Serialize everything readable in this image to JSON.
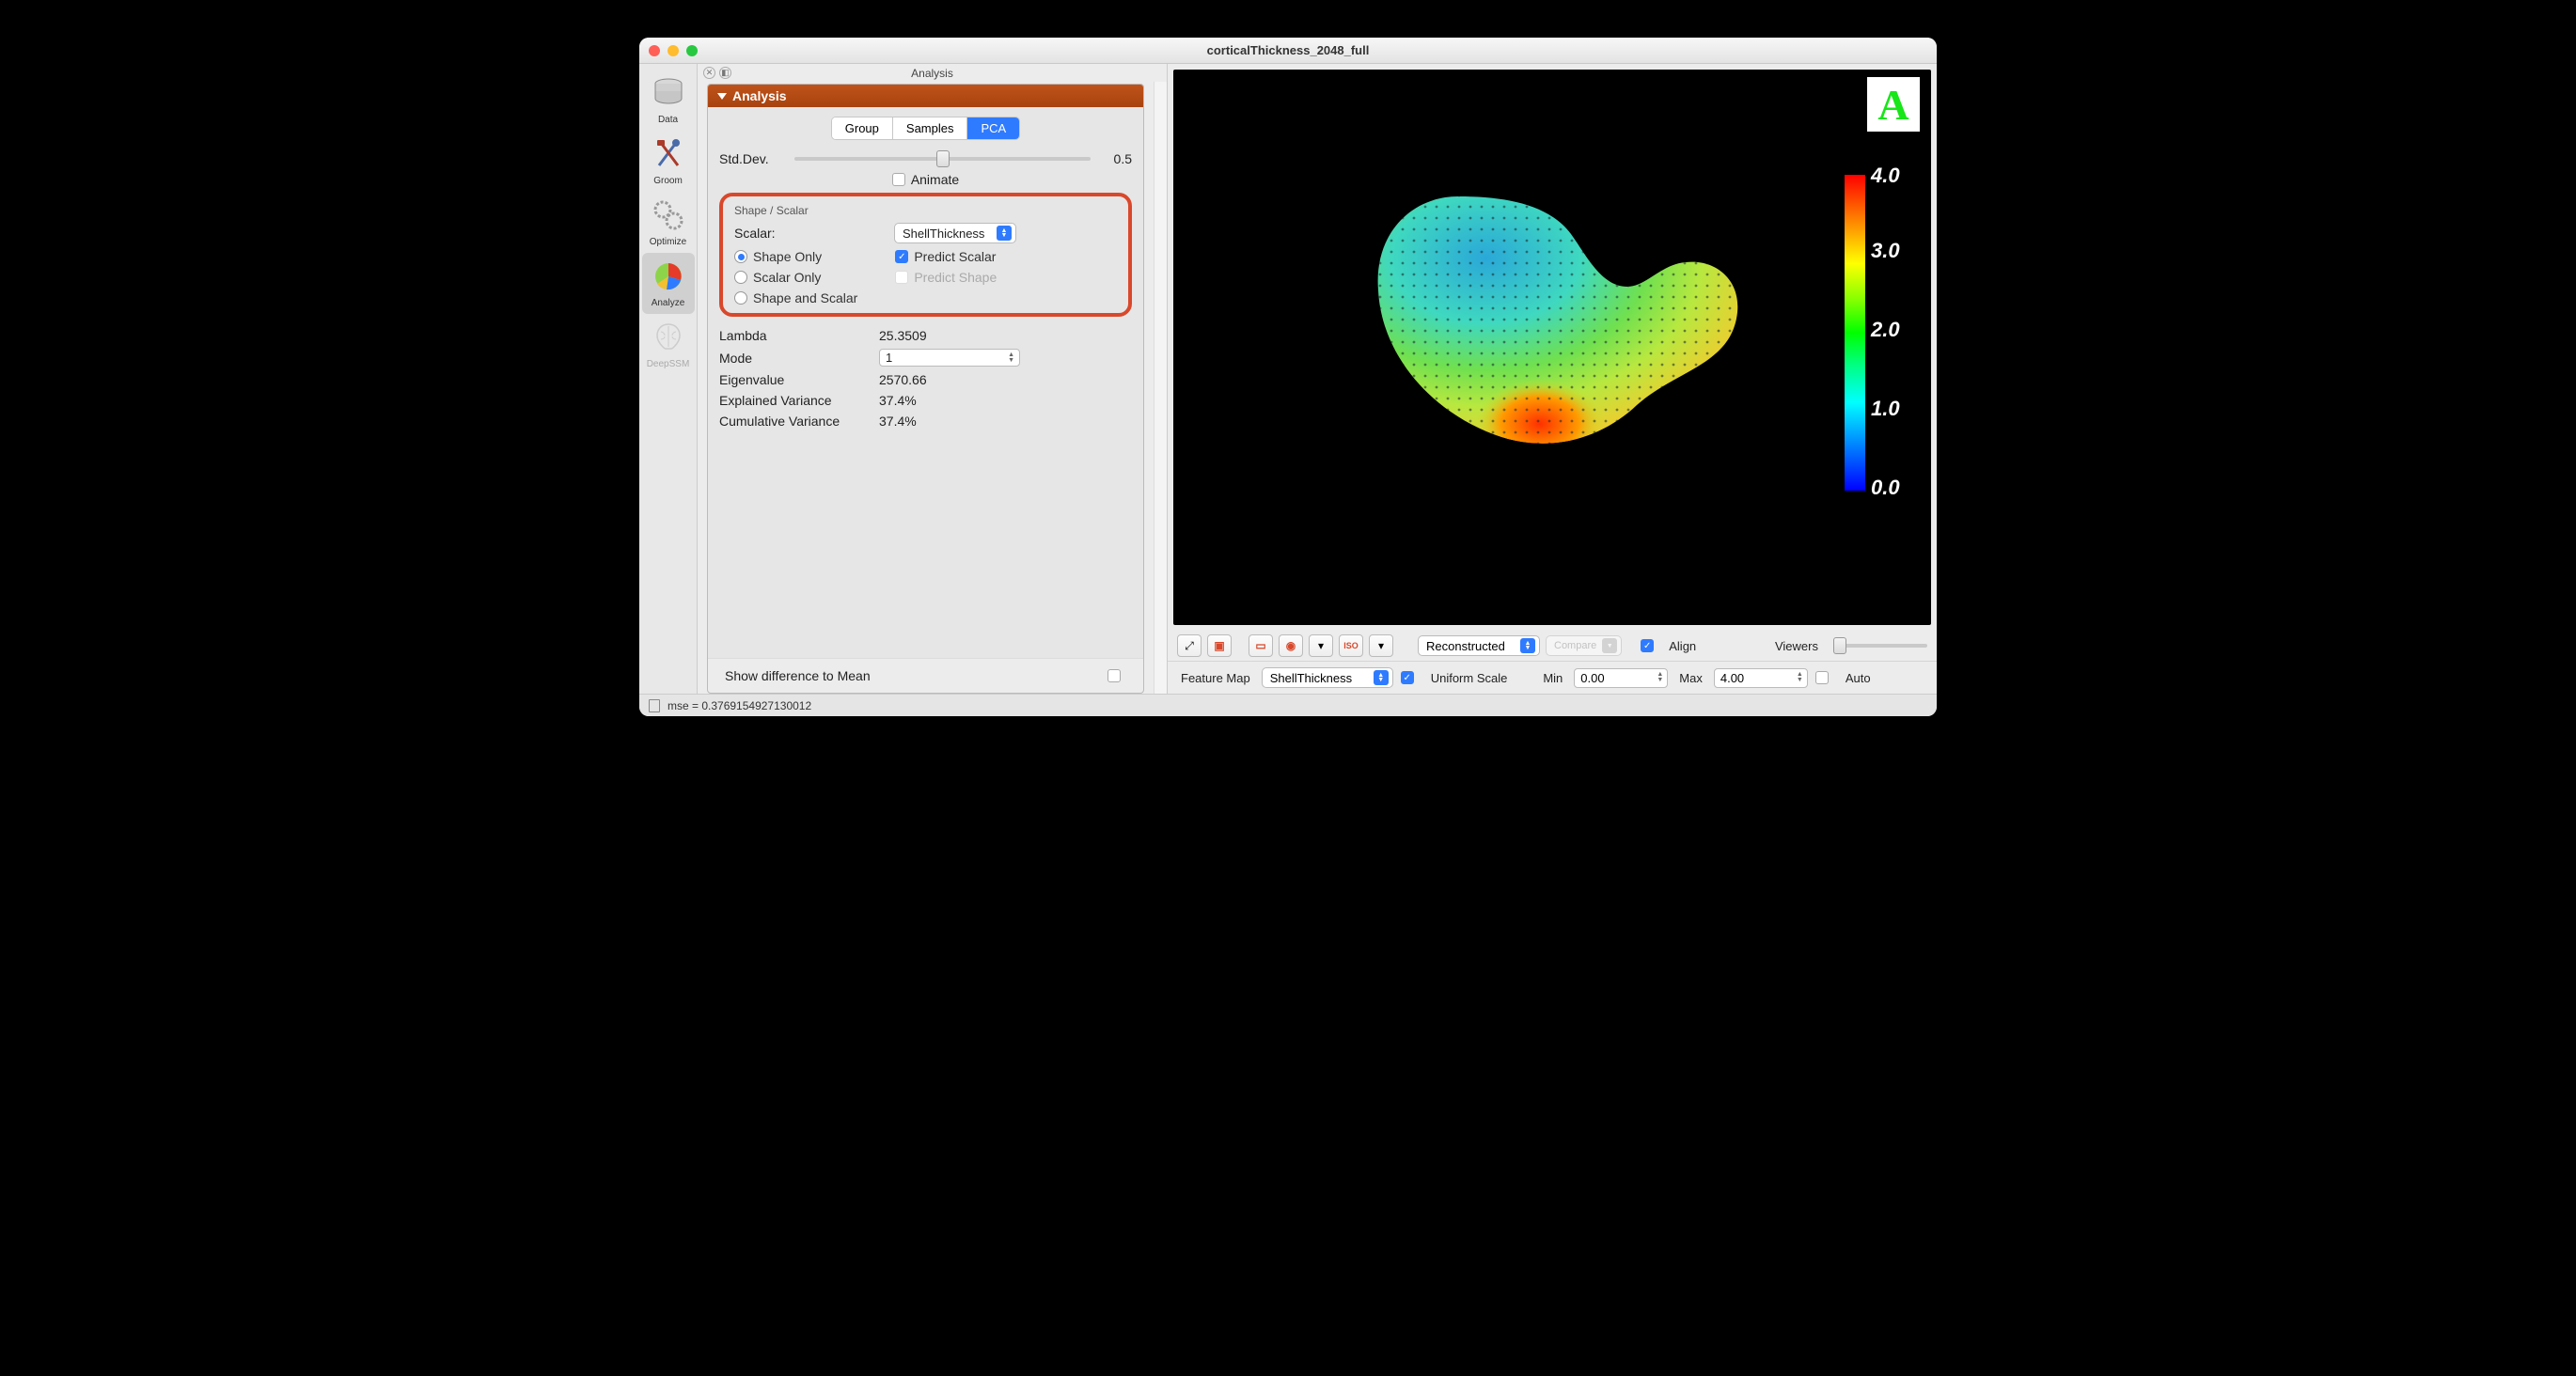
{
  "window": {
    "title": "corticalThickness_2048_full"
  },
  "sidebar": {
    "items": [
      {
        "id": "data",
        "label": "Data"
      },
      {
        "id": "groom",
        "label": "Groom"
      },
      {
        "id": "optimize",
        "label": "Optimize"
      },
      {
        "id": "analyze",
        "label": "Analyze",
        "active": true
      },
      {
        "id": "deepssm",
        "label": "DeepSSM",
        "disabled": true
      }
    ]
  },
  "panel": {
    "header_title": "Analysis",
    "section_title": "Analysis",
    "tabs": {
      "group": "Group",
      "samples": "Samples",
      "pca": "PCA",
      "active": "pca"
    },
    "stddev": {
      "label": "Std.Dev.",
      "value": "0.5"
    },
    "animate": {
      "label": "Animate",
      "checked": false
    },
    "shape_scalar": {
      "title": "Shape / Scalar",
      "scalar_label": "Scalar:",
      "scalar_value": "ShellThickness",
      "radios": {
        "shape_only": "Shape Only",
        "scalar_only": "Scalar Only",
        "shape_and_scalar": "Shape and Scalar",
        "selected": "shape_only"
      },
      "predict_scalar": {
        "label": "Predict Scalar",
        "checked": true
      },
      "predict_shape": {
        "label": "Predict Shape",
        "disabled": true
      }
    },
    "stats": {
      "lambda": {
        "label": "Lambda",
        "value": "25.3509"
      },
      "mode": {
        "label": "Mode",
        "value": "1"
      },
      "eigenvalue": {
        "label": "Eigenvalue",
        "value": "2570.66"
      },
      "explained_variance": {
        "label": "Explained Variance",
        "value": "37.4%"
      },
      "cumulative_variance": {
        "label": "Cumulative Variance",
        "value": "37.4%"
      }
    },
    "show_diff": {
      "label": "Show difference to Mean",
      "checked": false
    }
  },
  "viewport": {
    "badge": "A",
    "colorbar": {
      "ticks": [
        "4.0",
        "3.0",
        "2.0",
        "1.0",
        "0.0"
      ]
    }
  },
  "toolbar": {
    "reconstructed": {
      "value": "Reconstructed"
    },
    "compare": {
      "value": "Compare"
    },
    "align": {
      "label": "Align",
      "checked": true
    },
    "viewers": {
      "label": "Viewers"
    }
  },
  "featurebar": {
    "label": "Feature Map",
    "value": "ShellThickness",
    "uniform_scale": {
      "label": "Uniform Scale",
      "checked": true
    },
    "min": {
      "label": "Min",
      "value": "0.00"
    },
    "max": {
      "label": "Max",
      "value": "4.00"
    },
    "auto": {
      "label": "Auto",
      "checked": false
    }
  },
  "status": {
    "text": "mse = 0.3769154927130012"
  }
}
